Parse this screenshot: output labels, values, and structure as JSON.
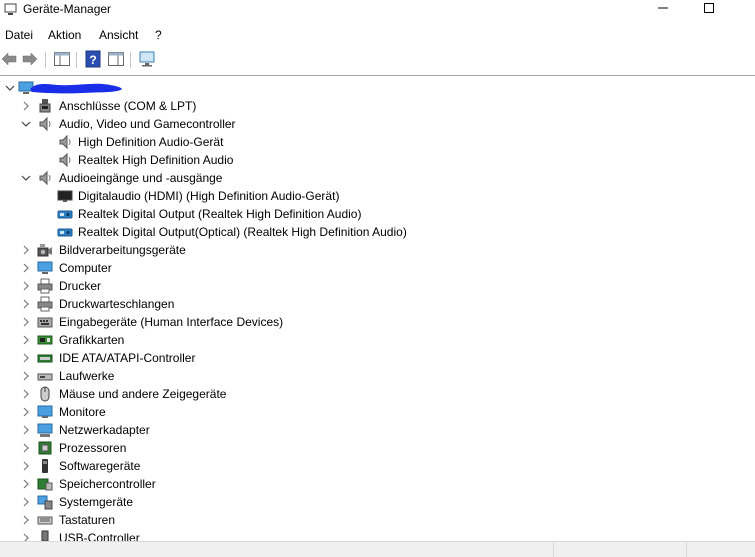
{
  "window": {
    "title": "Geräte-Manager"
  },
  "menu": [
    "Datei",
    "Aktion",
    "Ansicht",
    "?"
  ],
  "tree": {
    "root": {
      "label": ""
    },
    "items": [
      {
        "label": "Anschlüsse (COM & LPT)",
        "level": 1,
        "expanded": false,
        "icon": "port-icon"
      },
      {
        "label": "Audio, Video und Gamecontroller",
        "level": 1,
        "expanded": true,
        "icon": "speaker-icon"
      },
      {
        "label": "High Definition Audio-Gerät",
        "level": 2,
        "icon": "speaker-icon"
      },
      {
        "label": "Realtek High Definition Audio",
        "level": 2,
        "icon": "speaker-icon"
      },
      {
        "label": "Audioeingänge und -ausgänge",
        "level": 1,
        "expanded": true,
        "icon": "speaker-icon"
      },
      {
        "label": "Digitalaudio (HDMI) (High Definition Audio-Gerät)",
        "level": 2,
        "icon": "monitor-dark-icon"
      },
      {
        "label": "Realtek Digital Output (Realtek High Definition Audio)",
        "level": 2,
        "icon": "audio-device-icon"
      },
      {
        "label": "Realtek Digital Output(Optical) (Realtek High Definition Audio)",
        "level": 2,
        "icon": "audio-device-icon"
      },
      {
        "label": "Bildverarbeitungsgeräte",
        "level": 1,
        "expanded": false,
        "icon": "camera-icon"
      },
      {
        "label": "Computer",
        "level": 1,
        "expanded": false,
        "icon": "computer-icon"
      },
      {
        "label": "Drucker",
        "level": 1,
        "expanded": false,
        "icon": "printer-icon"
      },
      {
        "label": "Druckwarteschlangen",
        "level": 1,
        "expanded": false,
        "icon": "printer-icon"
      },
      {
        "label": "Eingabegeräte (Human Interface Devices)",
        "level": 1,
        "expanded": false,
        "icon": "hid-icon"
      },
      {
        "label": "Grafikkarten",
        "level": 1,
        "expanded": false,
        "icon": "display-adapter-icon"
      },
      {
        "label": "IDE ATA/ATAPI-Controller",
        "level": 1,
        "expanded": false,
        "icon": "ide-controller-icon"
      },
      {
        "label": "Laufwerke",
        "level": 1,
        "expanded": false,
        "icon": "drive-icon"
      },
      {
        "label": "Mäuse und andere Zeigegeräte",
        "level": 1,
        "expanded": false,
        "icon": "mouse-icon"
      },
      {
        "label": "Monitore",
        "level": 1,
        "expanded": false,
        "icon": "monitor-icon"
      },
      {
        "label": "Netzwerkadapter",
        "level": 1,
        "expanded": false,
        "icon": "network-adapter-icon"
      },
      {
        "label": "Prozessoren",
        "level": 1,
        "expanded": false,
        "icon": "processor-icon"
      },
      {
        "label": "Softwaregeräte",
        "level": 1,
        "expanded": false,
        "icon": "software-device-icon"
      },
      {
        "label": "Speichercontroller",
        "level": 1,
        "expanded": false,
        "icon": "storage-controller-icon"
      },
      {
        "label": "Systemgeräte",
        "level": 1,
        "expanded": false,
        "icon": "system-device-icon"
      },
      {
        "label": "Tastaturen",
        "level": 1,
        "expanded": false,
        "icon": "keyboard-icon"
      },
      {
        "label": "USB-Controller",
        "level": 1,
        "expanded": false,
        "icon": "usb-icon"
      }
    ]
  },
  "colors": {
    "redaction": "#1a2ee8",
    "tree_border": "#a0a0a0",
    "statusbar": "#f0f0f0"
  }
}
